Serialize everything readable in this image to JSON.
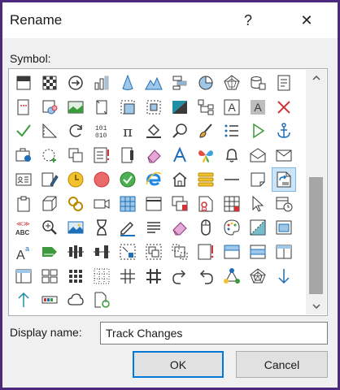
{
  "window": {
    "title": "Rename",
    "help_glyph": "?",
    "close_glyph": "✕"
  },
  "symbol_picker": {
    "label": "Symbol:",
    "icons": [
      [
        "header-icon",
        "checkerboard-icon",
        "arrow-circle-icon",
        "bar-chart-icon",
        "cone-icon",
        "mountain-chart-icon",
        "gantt-icon",
        "pie-chart-icon",
        "spider-chart-icon",
        "database-icon",
        "document-list-icon",
        "scrollbar"
      ],
      [
        "book-icon",
        "group-chart-icon",
        "picture-icon",
        "page-icon",
        "picture-frame-icon",
        "crop-icon",
        "shade-icon",
        "hierarchy-icon",
        "letter-a-icon",
        "shaded-letter-a-icon",
        "red-x-icon"
      ],
      [
        "checkmark-icon",
        "ruler-triangle-icon",
        "refresh-icon",
        "binary-icon",
        "pi-icon",
        "paint-bucket-icon",
        "magnifier-icon",
        "paint-brush-icon",
        "bullet-list-icon",
        "play-icon",
        "anchor-icon"
      ],
      [
        "briefcase-icon",
        "dashed-circle-icon",
        "copy-icon",
        "red-bullets-icon",
        "page-fold-icon",
        "eraser-icon",
        "letter-pen-icon",
        "colorful-butterfly-icon",
        "bell-icon",
        "open-envelope-icon",
        "envelope-icon"
      ],
      [
        "contact-card-icon",
        "edit-list-icon",
        "clock-icon",
        "red-circle-icon",
        "green-check-icon",
        "ie-icon",
        "home-icon",
        "stack-icon",
        "dash-icon",
        "sticky-note-icon",
        "track-changes-icon"
      ],
      [
        "clipboard-icon",
        "cube-icon",
        "link-icon",
        "video-icon",
        "table-icon",
        "window-icon",
        "two-windows-icon",
        "certificate-icon",
        "grid-icon",
        "cursor-icon",
        "calendar-clock-icon"
      ],
      [
        "spell-check-icon",
        "zoom-in-icon",
        "image-icon",
        "hourglass-icon",
        "pencil-icon",
        "text-lines-icon",
        "pink-eraser-icon",
        "mouse-icon",
        "palette-icon",
        "corner-gradient-icon",
        "small-window-icon"
      ],
      [
        "text-size-icon",
        "arrow-sign-icon",
        "align-distribute-icon",
        "align-center-icon",
        "dotted-select-icon",
        "group-objects-icon",
        "ungroup-objects-icon",
        "red-mark-icon",
        "header-window-icon",
        "blue-band-icon",
        "layout-icon"
      ],
      [
        "sidebar-layout-icon",
        "thumbnail-grid-icon",
        "dot-grid-icon",
        "grid-dots-icon",
        "hash-icon",
        "hash-bold-icon",
        "redo-icon",
        "undo-icon",
        "network-icon",
        "spider-web-icon",
        "down-arrow-icon"
      ],
      [
        "up-arrow-icon",
        "toolbar-icon",
        "cloud-icon",
        "refresh-page-icon"
      ]
    ],
    "selected_icon": "track-changes-icon"
  },
  "display_name": {
    "label": "Display name:",
    "value": "Track Changes"
  },
  "buttons": {
    "ok": "OK",
    "cancel": "Cancel"
  },
  "colors": {
    "accent": "#0078d7",
    "icon_dark": "#3a3a3a",
    "icon_blue": "#1e6fb8",
    "icon_green": "#3c9a3c",
    "icon_red": "#d13438",
    "selection": "#cce4f7"
  }
}
